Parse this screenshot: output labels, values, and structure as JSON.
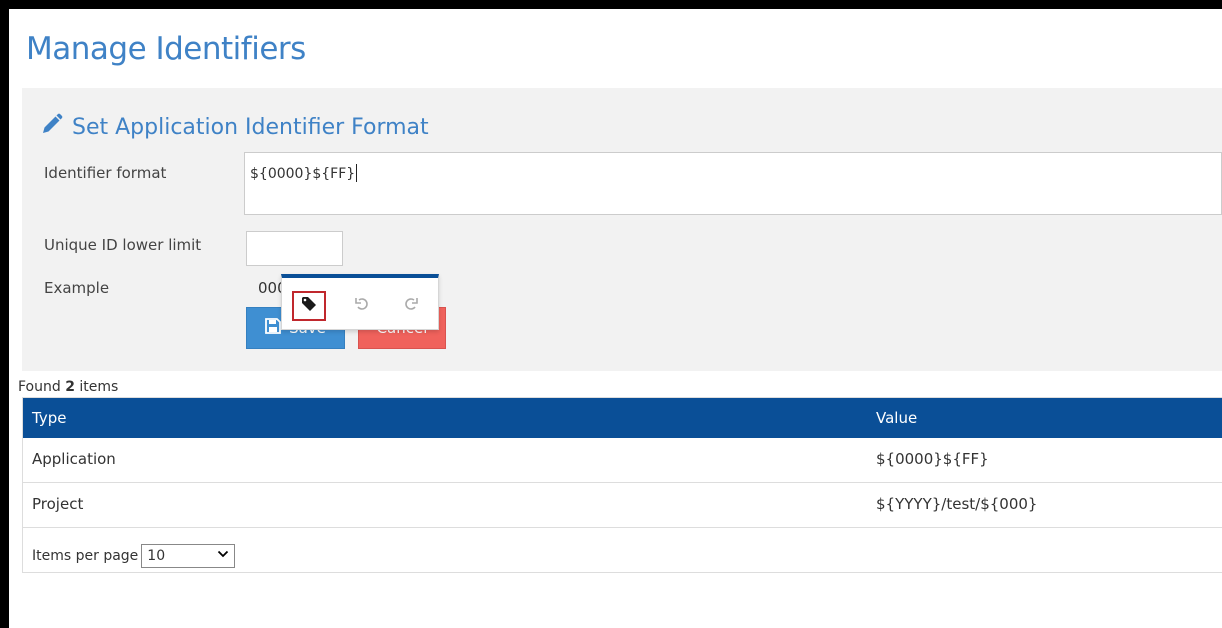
{
  "page": {
    "title": "Manage Identifiers"
  },
  "form": {
    "section_title": "Set Application Identifier Format",
    "identifier_format_label": "Identifier format",
    "identifier_format_value": "${0000}${FF}",
    "lower_limit_label": "Unique ID lower limit",
    "lower_limit_value": "",
    "example_label": "Example",
    "example_value": "000016",
    "save_label": "Save",
    "cancel_label": "Cancel"
  },
  "editor_toolbar": {
    "items": [
      {
        "icon": "tag-icon",
        "selected": true
      },
      {
        "icon": "undo-icon"
      },
      {
        "icon": "redo-icon"
      }
    ]
  },
  "results": {
    "found_prefix": "Found",
    "found_count": "2",
    "found_suffix": "items",
    "columns": [
      "Type",
      "Value"
    ],
    "rows": [
      {
        "type": "Application",
        "value": "${0000}${FF}"
      },
      {
        "type": "Project",
        "value": "${YYYY}/test/${000}"
      }
    ],
    "items_per_page_label": "Items per page",
    "items_per_page_value": "10"
  },
  "colors": {
    "accent_blue": "#3f82c6",
    "header_blue": "#0a4f97",
    "save_blue": "#3f8fd2",
    "cancel_red": "#f0625c",
    "highlight_red": "#c0282d"
  }
}
